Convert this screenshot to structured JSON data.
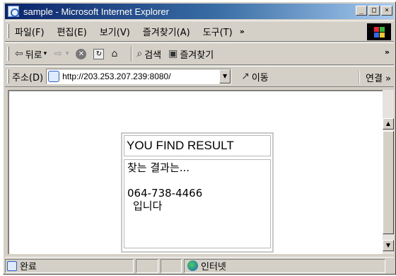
{
  "window": {
    "title": "sample - Microsoft Internet Explorer",
    "buttons": [
      "_",
      "□",
      "×"
    ]
  },
  "menubar": {
    "items": [
      "파일(F)",
      "편집(E)",
      "보기(V)",
      "즐겨찾기(A)",
      "도구(T)"
    ],
    "overflow": "»"
  },
  "toolbar": {
    "back_label": "뒤로",
    "search_label": "검색",
    "favorites_label": "즐겨찾기",
    "overflow": "»"
  },
  "addressbar": {
    "label": "주소(D)",
    "url": "http://203.253.207.239:8080/",
    "go_label": "이동",
    "links_label": "연결 »"
  },
  "page": {
    "result_title": "YOU FIND RESULT",
    "result_intro": "찾는 결과는...",
    "phone": "064-738-4466",
    "suffix": "입니다"
  },
  "statusbar": {
    "status_text": "완료",
    "zone_label": "인터넷"
  },
  "colors": {
    "titlebar_start": "#0a246a",
    "titlebar_end": "#a6caf0",
    "chrome": "#d4d0c8"
  }
}
